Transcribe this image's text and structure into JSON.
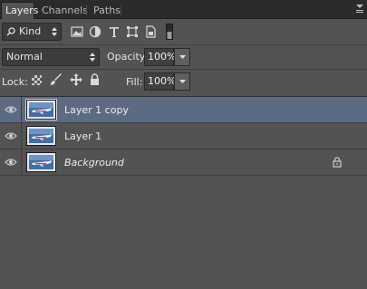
{
  "tabs": [
    {
      "label": "Layers",
      "active": true
    },
    {
      "label": "Channels",
      "active": false
    },
    {
      "label": "Paths",
      "active": false
    }
  ],
  "filter": {
    "kind_label": "Kind",
    "icons": [
      "search-icon",
      "pixel-filter-icon",
      "adjustment-filter-icon",
      "type-filter-icon",
      "shape-filter-icon",
      "smart-object-filter-icon",
      "filter-toggle-icon"
    ]
  },
  "blend": {
    "mode": "Normal",
    "opacity_label": "Opacity:",
    "opacity_value": "100%"
  },
  "lock": {
    "label": "Lock:",
    "icons": [
      "lock-transparent-icon",
      "lock-pixels-icon",
      "lock-position-icon",
      "lock-all-icon"
    ],
    "fill_label": "Fill:",
    "fill_value": "100%"
  },
  "layers": [
    {
      "name": "Layer 1 copy",
      "selected": true,
      "visible": true,
      "locked": false,
      "italic": false
    },
    {
      "name": "Layer 1",
      "selected": false,
      "visible": true,
      "locked": false,
      "italic": false
    },
    {
      "name": "Background",
      "selected": false,
      "visible": true,
      "locked": true,
      "italic": true
    }
  ],
  "colors": {
    "panel_bg": "#535353",
    "selected_row": "#5d6b82",
    "tabbar_bg": "#2b2b2b"
  }
}
